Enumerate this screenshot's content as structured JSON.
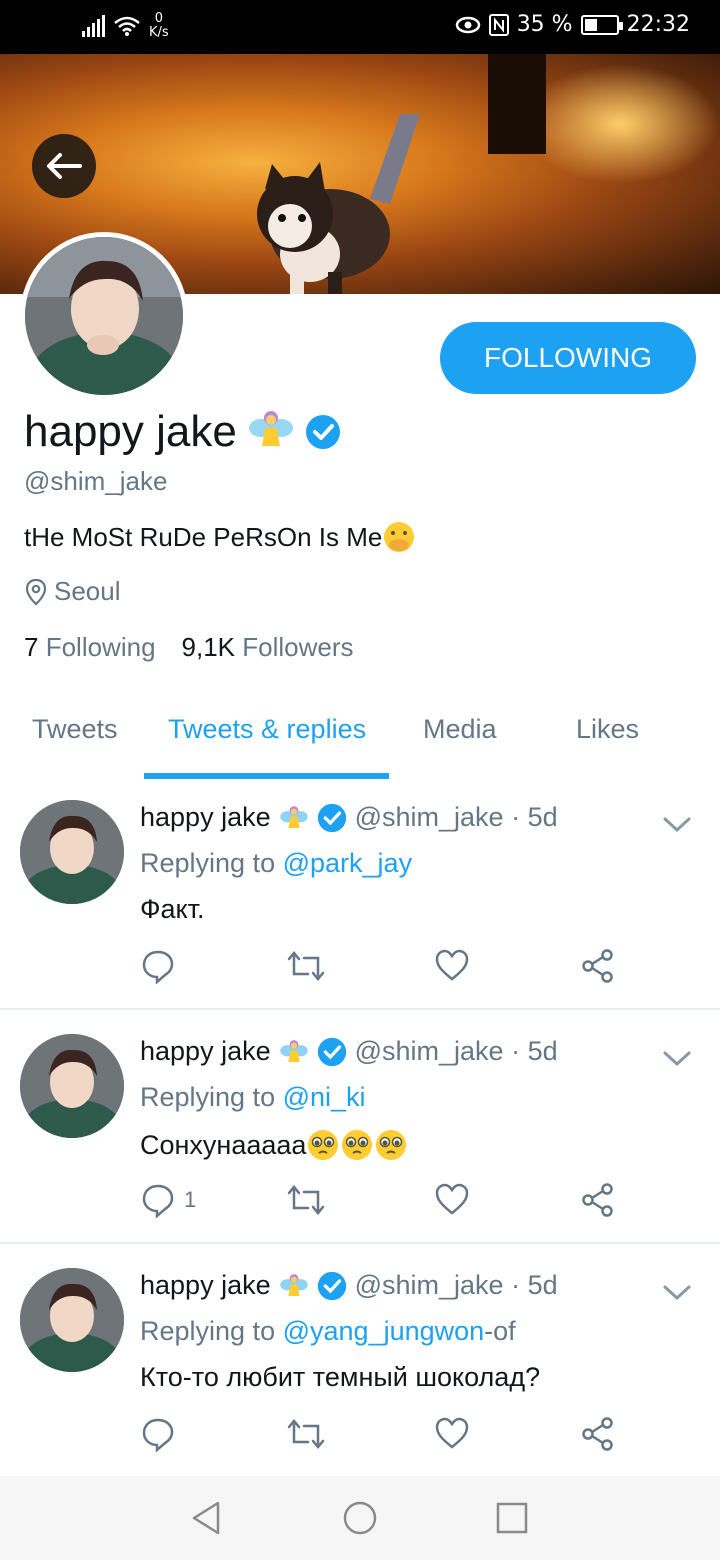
{
  "status_bar": {
    "speed_value": "0",
    "speed_unit": "K/s",
    "battery": "35 %",
    "time": "22:32"
  },
  "profile": {
    "name": "happy jake",
    "handle": "@shim_jake",
    "bio": "tHe MoSt RuDe PeRsOn Is Me",
    "location": "Seoul",
    "following_count": "7",
    "following_label": "Following",
    "followers_count": "9,1K",
    "followers_label": "Followers",
    "follow_button": "FOLLOWING"
  },
  "tabs": [
    {
      "label": "Tweets"
    },
    {
      "label": "Tweets & replies"
    },
    {
      "label": "Media"
    },
    {
      "label": "Likes"
    }
  ],
  "active_tab": "Tweets & replies",
  "tweets": [
    {
      "name": "happy jake",
      "handle_time": "@shim_jake · 5d",
      "replying_prefix": "Replying to",
      "mention": "@park_jay",
      "mention_suffix": "",
      "text": "Факт.",
      "reply_count": ""
    },
    {
      "name": "happy jake",
      "handle_time": "@shim_jake · 5d",
      "replying_prefix": "Replying to",
      "mention": "@ni_ki",
      "mention_suffix": "",
      "text": "Сонхунааааа",
      "reply_count": "1"
    },
    {
      "name": "happy jake",
      "handle_time": "@shim_jake · 5d",
      "replying_prefix": "Replying to",
      "mention": "@yang_jungwon",
      "mention_suffix": "-of",
      "text": "Кто-то любит темный шоколад?",
      "reply_count": ""
    }
  ],
  "colors": {
    "accent": "#1da1f2",
    "muted": "#657786",
    "text": "#14171a"
  }
}
